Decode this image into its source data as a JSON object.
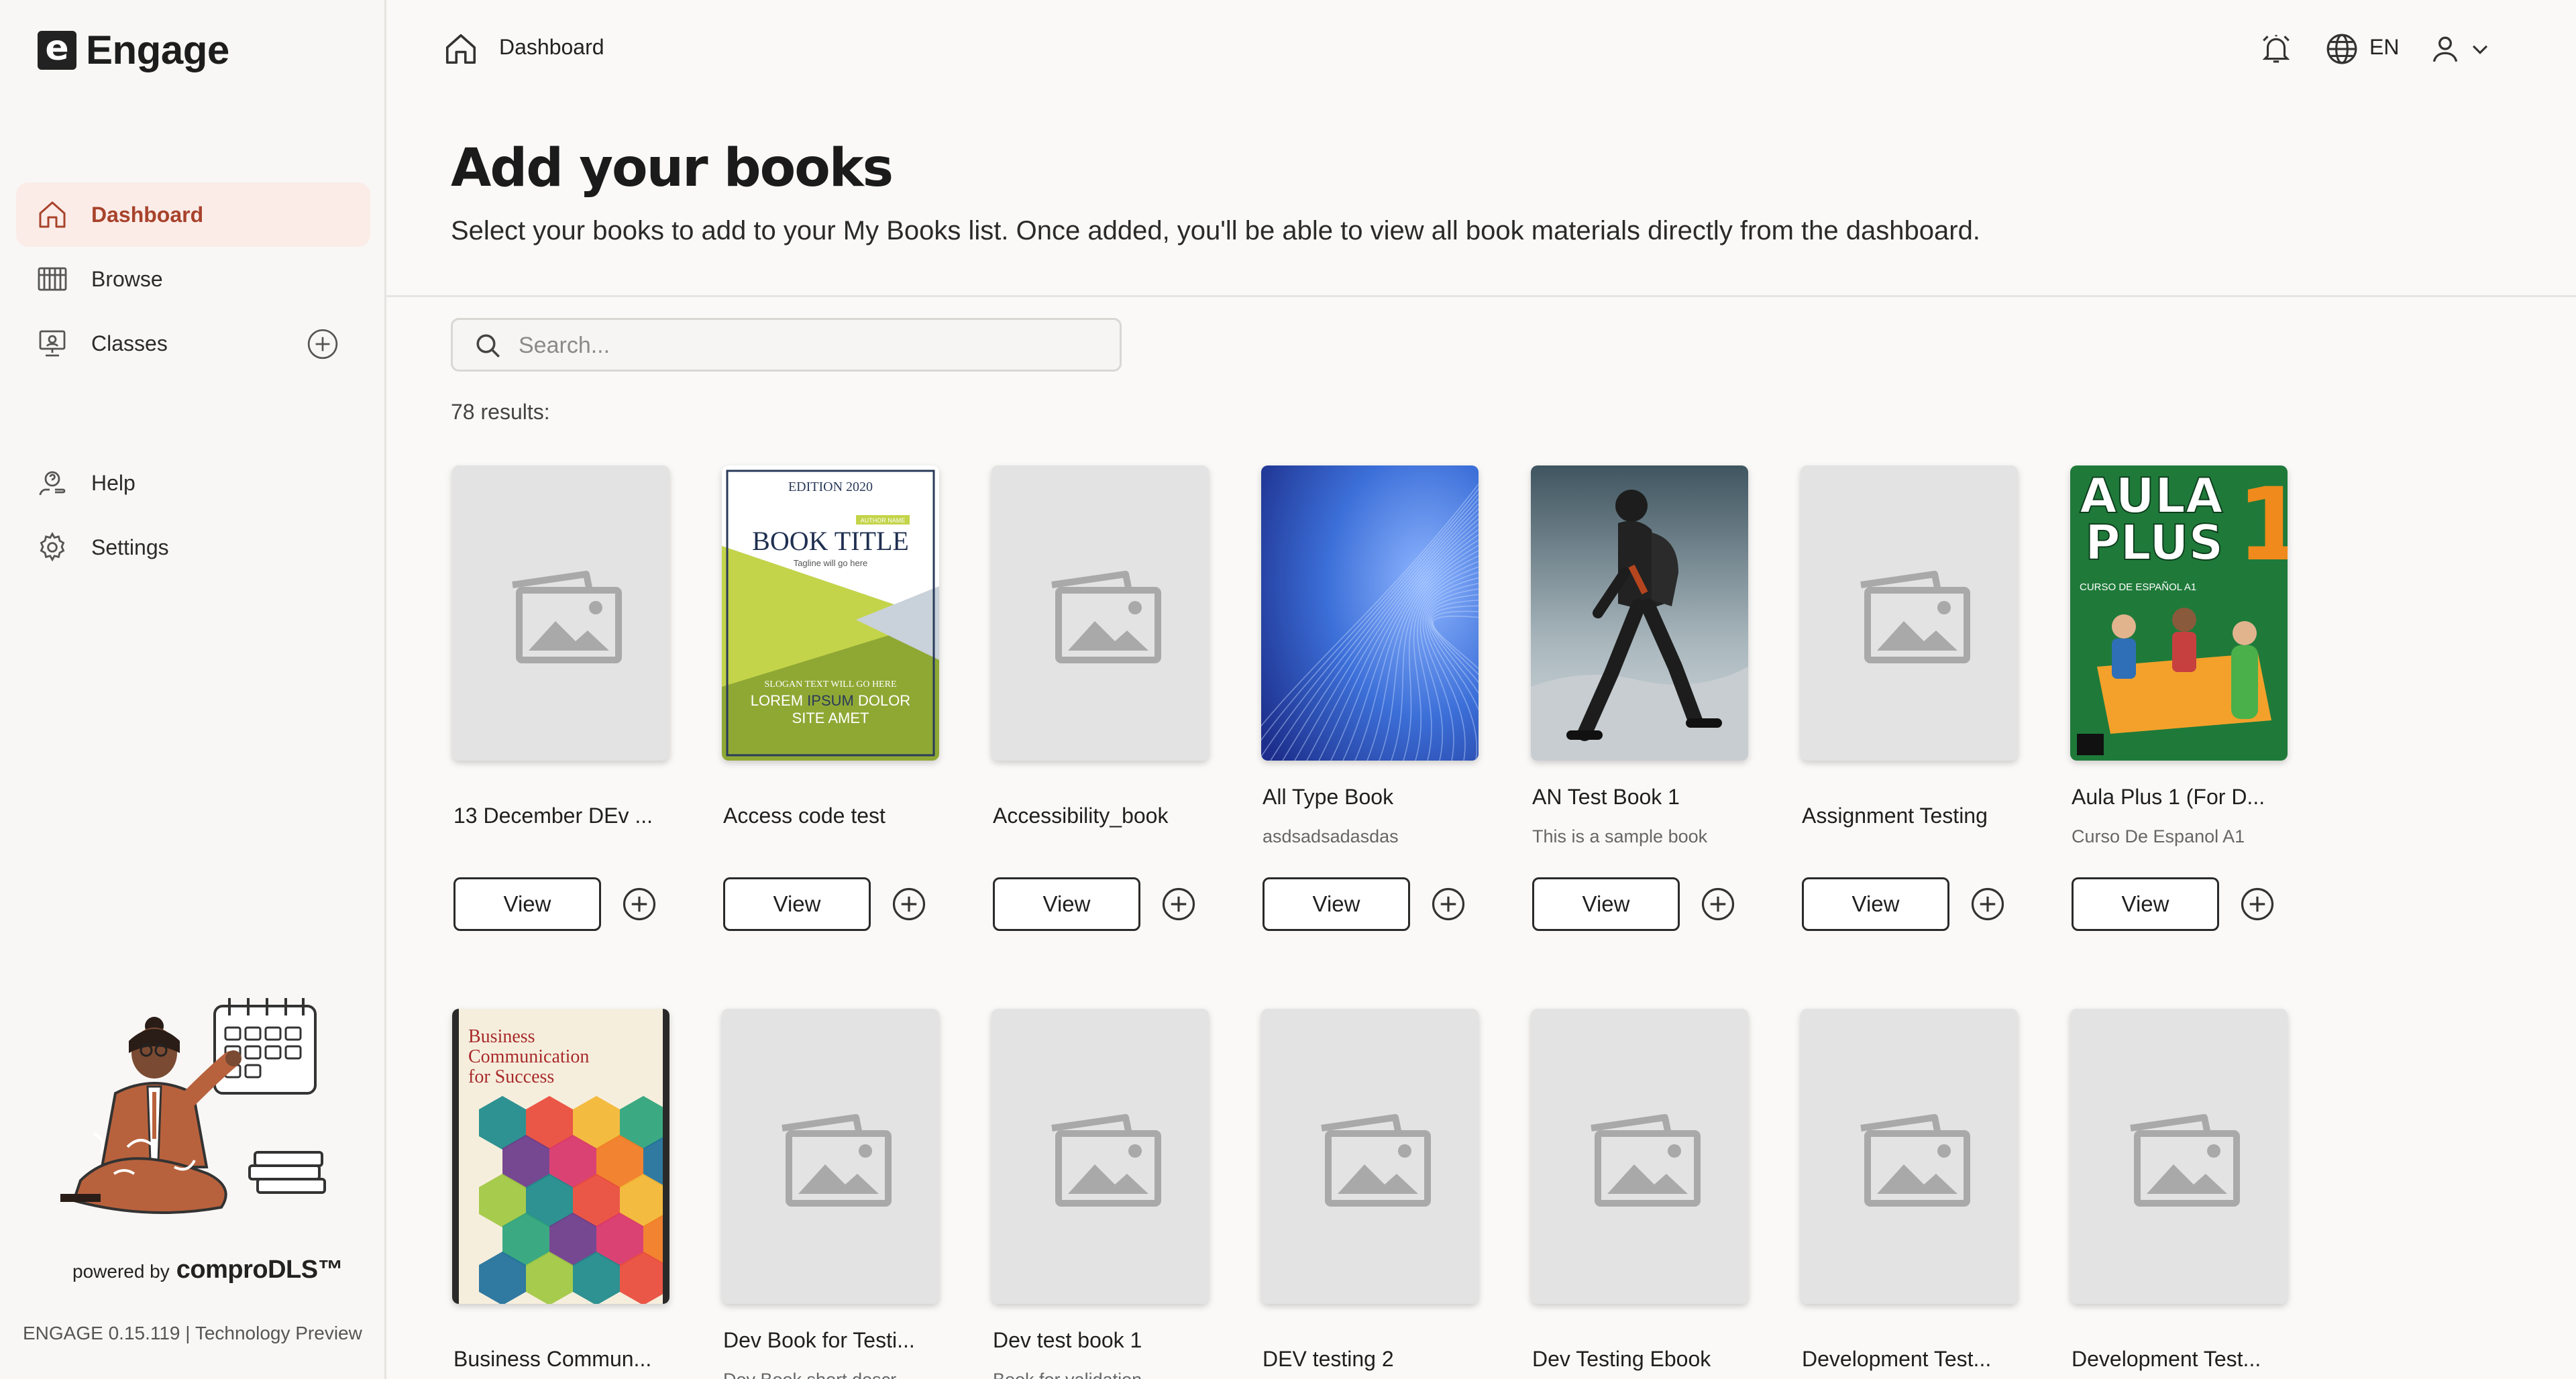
{
  "app": {
    "logo_letter": "e",
    "name": "Engage"
  },
  "sidebar": {
    "items": [
      {
        "label": "Dashboard",
        "icon": "home-icon",
        "active": true
      },
      {
        "label": "Browse",
        "icon": "library-icon"
      },
      {
        "label": "Classes",
        "icon": "classroom-icon"
      },
      {
        "label": "Help",
        "icon": "help-icon"
      },
      {
        "label": "Settings",
        "icon": "gear-icon"
      }
    ],
    "powered_by": "powered by",
    "brand": "comproDLS™",
    "version": "ENGAGE 0.15.119 | Technology Preview"
  },
  "topbar": {
    "breadcrumb": "Dashboard",
    "language": "EN"
  },
  "main": {
    "title": "Add your books",
    "subtitle": "Select your books to add to your My Books list. Once added, you'll be able to view all book materials directly from the dashboard.",
    "search_placeholder": "Search...",
    "results": "78 results:",
    "view_label": "View"
  },
  "books": [
    {
      "title": "13 December DEv ...",
      "desc": "",
      "cover": "placeholder"
    },
    {
      "title": "Access code test",
      "desc": "",
      "cover": "book-title"
    },
    {
      "title": "Accessibility_book",
      "desc": "",
      "cover": "placeholder"
    },
    {
      "title": "All Type Book",
      "desc": "asdsadsadasdas",
      "cover": "blue-waves"
    },
    {
      "title": "AN Test Book 1",
      "desc": "This is a sample book",
      "cover": "hiker"
    },
    {
      "title": "Assignment Testing",
      "desc": "",
      "cover": "placeholder"
    },
    {
      "title": "Aula Plus 1 (For D...",
      "desc": "Curso De Espanol A1",
      "cover": "aula-plus"
    },
    {
      "title": "Business Commun...",
      "desc": "",
      "cover": "business"
    },
    {
      "title": "Dev Book for Testi...",
      "desc": "Dev Book short descr...",
      "cover": "placeholder"
    },
    {
      "title": "Dev test book 1",
      "desc": "Book for validation",
      "cover": "placeholder"
    },
    {
      "title": "DEV testing 2",
      "desc": "",
      "cover": "placeholder"
    },
    {
      "title": "Dev Testing Ebook",
      "desc": "",
      "cover": "placeholder"
    },
    {
      "title": "Development Test...",
      "desc": "",
      "cover": "placeholder"
    },
    {
      "title": "Development Test...",
      "desc": "",
      "cover": "placeholder"
    }
  ],
  "cover_text": {
    "book_title": {
      "edition": "EDITION 2020",
      "author": "AUTHOR NAME",
      "title": "BOOK TITLE",
      "tagline": "Tagline will go here",
      "slogan": "SLOGAN TEXT WILL GO HERE",
      "lorem1": "LOREM",
      "ipsum": "IPSUM",
      "dolor": "DOLOR",
      "sit_amet": "SITE AMET"
    },
    "aula_plus": {
      "line1": "AULA",
      "line2": "PLUS",
      "num": "1",
      "sub": "CURSO DE ESPAÑOL A1"
    },
    "business": {
      "line1": "Business",
      "line2": "Communication",
      "line3": "for Success"
    }
  },
  "colors": {
    "accent": "#a8432b",
    "active_bg": "#fbece8",
    "aula_green": "#1f7a3a"
  }
}
